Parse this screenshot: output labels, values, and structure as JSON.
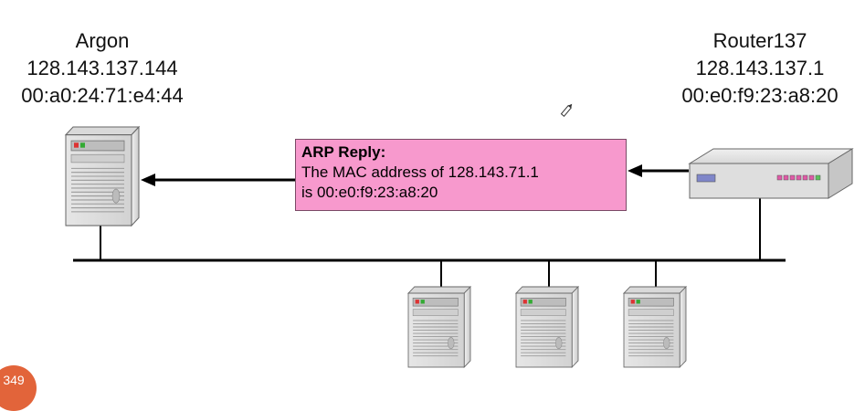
{
  "hosts": {
    "argon": {
      "name": "Argon",
      "ip": "128.143.137.144",
      "mac": "00:a0:24:71:e4:44",
      "icon": "server-tower-icon"
    },
    "router": {
      "name": "Router137",
      "ip": "128.143.137.1",
      "mac": "00:e0:f9:23:a8:20",
      "icon": "router-icon"
    }
  },
  "arp_message": {
    "title": "ARP Reply:",
    "line1": "The MAC address of 128.143.71.1",
    "line2": "is 00:e0:f9:23:a8:20",
    "fill_color": "#f799cd"
  },
  "other_hosts_icon": "server-tower-icon",
  "page_number": "349",
  "badge_color": "#e2643a"
}
